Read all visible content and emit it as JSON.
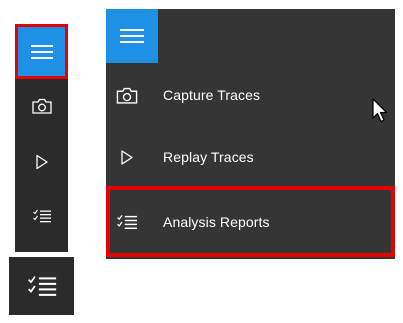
{
  "colors": {
    "accent": "#1e90e6",
    "highlight_box": "#e60000",
    "panel_bg": "#353535",
    "strip_bg": "#2b2b2b",
    "text": "#ffffff"
  },
  "collapsed_nav": {
    "menu_icon": "hamburger-icon",
    "icons": [
      "camera-icon",
      "play-icon",
      "checklist-icon"
    ],
    "enlarged_icon": "checklist-icon"
  },
  "expanded_nav": {
    "menu_icon": "hamburger-icon",
    "items": [
      {
        "icon": "camera-icon",
        "label": "Capture Traces"
      },
      {
        "icon": "play-icon",
        "label": "Replay Traces"
      },
      {
        "icon": "checklist-icon",
        "label": "Analysis Reports",
        "highlighted": true
      }
    ]
  }
}
